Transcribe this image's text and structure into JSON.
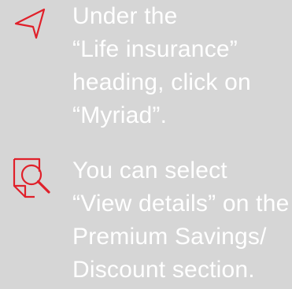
{
  "colors": {
    "background": "#d6d6d6",
    "text": "#ffffff",
    "accent": "#e0202a"
  },
  "steps": [
    {
      "icon": "send-arrow-icon",
      "lines": [
        "Under the",
        "“Life insurance”",
        "heading, click on",
        "“Myriad”."
      ]
    },
    {
      "icon": "document-search-icon",
      "lines": [
        "You can select",
        "“View details” on the",
        "Premium Savings/",
        "Discount section."
      ]
    }
  ]
}
